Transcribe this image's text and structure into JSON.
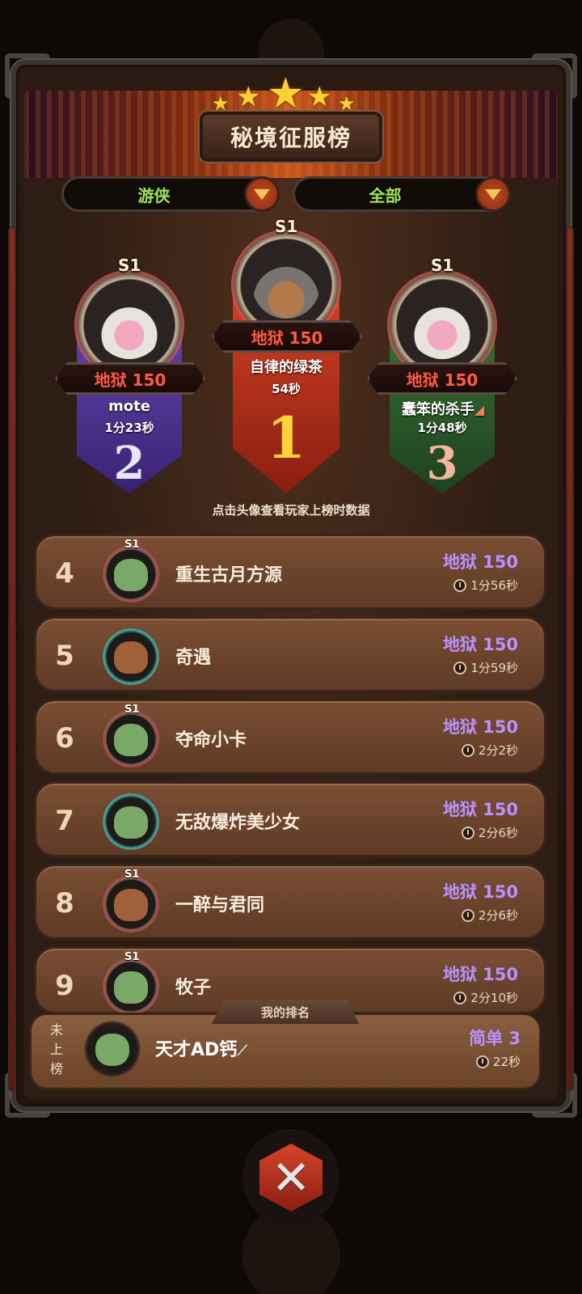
{
  "title": "秘境征服榜",
  "filters": {
    "class": "游侠",
    "scope": "全部"
  },
  "season_badge": "S1",
  "podium": [
    {
      "place": "2",
      "difficulty": "地狱 150",
      "name": "mote",
      "time": "1分23秒"
    },
    {
      "place": "1",
      "difficulty": "地狱 150",
      "name": "自律的绿茶",
      "time": "54秒"
    },
    {
      "place": "3",
      "difficulty": "地狱 150",
      "name": "蠢笨的杀手",
      "time": "1分48秒"
    }
  ],
  "hint": "点击头像查看玩家上榜时数据",
  "rows": [
    {
      "rank": "4",
      "name": "重生古月方源",
      "difficulty": "地狱 150",
      "time": "1分56秒"
    },
    {
      "rank": "5",
      "name": "奇遇",
      "difficulty": "地狱 150",
      "time": "1分59秒"
    },
    {
      "rank": "6",
      "name": "夺命小卡",
      "difficulty": "地狱 150",
      "time": "2分2秒"
    },
    {
      "rank": "7",
      "name": "无敌爆炸美少女",
      "difficulty": "地狱 150",
      "time": "2分6秒"
    },
    {
      "rank": "8",
      "name": "一醉与君同",
      "difficulty": "地狱 150",
      "time": "2分6秒"
    },
    {
      "rank": "9",
      "name": "牧子",
      "difficulty": "地狱 150",
      "time": "2分10秒"
    }
  ],
  "my_rank": {
    "tag": "我的排名",
    "status": "未上榜",
    "name": "天才AD钙",
    "difficulty": "简单 3",
    "time": "22秒"
  },
  "colors": {
    "difficulty_hell": "#b892ff",
    "filter_text": "#9ee75a",
    "accent_red": "#ff5a44"
  }
}
